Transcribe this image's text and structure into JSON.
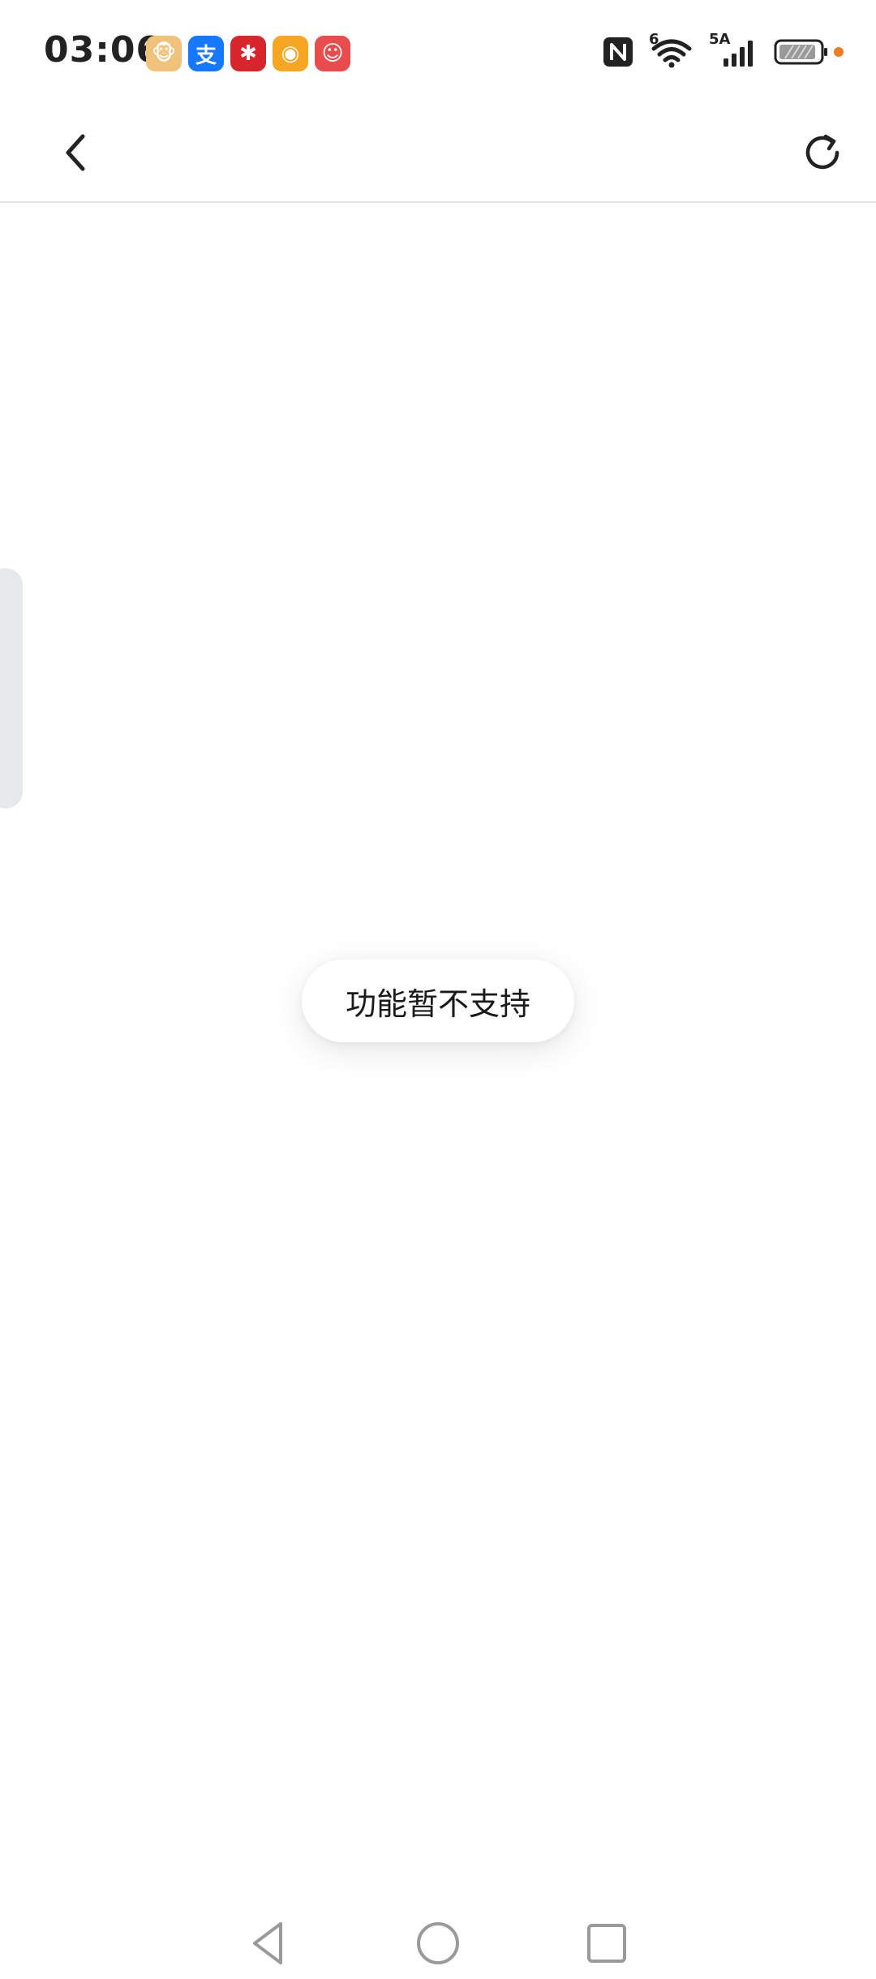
{
  "status_bar": {
    "time": "03:06",
    "notification_apps": [
      {
        "name": "cartoon-app",
        "glyph": "🐵",
        "color": "#f0c27a"
      },
      {
        "name": "alipay",
        "glyph": "支",
        "color": "#1677ff"
      },
      {
        "name": "red-app",
        "glyph": "✱",
        "color": "#d7262b"
      },
      {
        "name": "weibo",
        "glyph": "◉",
        "color": "#f6a623"
      },
      {
        "name": "game-app",
        "glyph": "☺",
        "color": "#e84c4c"
      }
    ],
    "network_label": "5A",
    "wifi_label": "6"
  },
  "toolbar": {
    "back_icon": "chevron-left-icon",
    "refresh_icon": "refresh-icon"
  },
  "toast": {
    "message": "功能暂不支持"
  },
  "nav": {
    "back_icon": "triangle-back-icon",
    "home_icon": "circle-home-icon",
    "recents_icon": "square-recents-icon"
  }
}
